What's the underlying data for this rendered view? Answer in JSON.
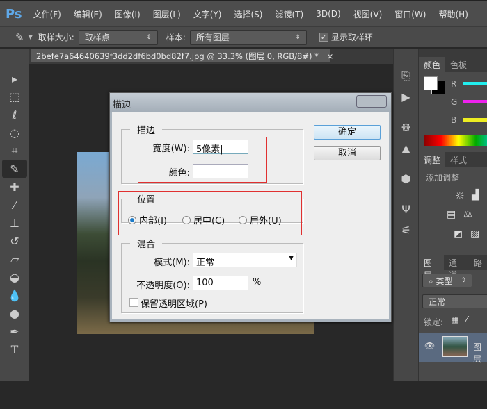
{
  "app": {
    "logo": "Ps"
  },
  "menu": [
    "文件(F)",
    "编辑(E)",
    "图像(I)",
    "图层(L)",
    "文字(Y)",
    "选择(S)",
    "滤镜(T)",
    "3D(D)",
    "视图(V)",
    "窗口(W)",
    "帮助(H)"
  ],
  "options": {
    "sample_size_label": "取样大小:",
    "sample_size_value": "取样点",
    "sample_label": "样本:",
    "sample_value": "所有图层",
    "show_ring_label": "显示取样环",
    "show_ring_checked": true
  },
  "document": {
    "tab_title": "2befe7a64640639f3dd2df6bd0bd82f7.jpg @ 33.3% (图层 0, RGB/8#) *",
    "close": "×"
  },
  "panels": {
    "color_tabs": [
      "颜色",
      "色板"
    ],
    "channels": [
      "R",
      "G",
      "B"
    ],
    "adjust_tabs": [
      "调整",
      "样式"
    ],
    "adjust_title": "添加调整",
    "layers_tabs": [
      "图层",
      "通道",
      "路"
    ],
    "filter_value": "类型",
    "blend_value": "正常",
    "lock_label": "锁定:",
    "layer_name": "图层"
  },
  "dialog": {
    "title": "描边",
    "stroke_group": "描边",
    "width_label": "宽度(W):",
    "width_value": "5像素",
    "color_label": "颜色:",
    "position_group": "位置",
    "positions": [
      {
        "label": "内部(I)",
        "checked": true
      },
      {
        "label": "居中(C)",
        "checked": false
      },
      {
        "label": "居外(U)",
        "checked": false
      }
    ],
    "blend_group": "混合",
    "mode_label": "模式(M):",
    "mode_value": "正常",
    "opacity_label": "不透明度(O):",
    "opacity_value": "100",
    "opacity_unit": "%",
    "preserve_label": "保留透明区域(P)",
    "preserve_checked": false,
    "ok": "确定",
    "cancel": "取消"
  }
}
